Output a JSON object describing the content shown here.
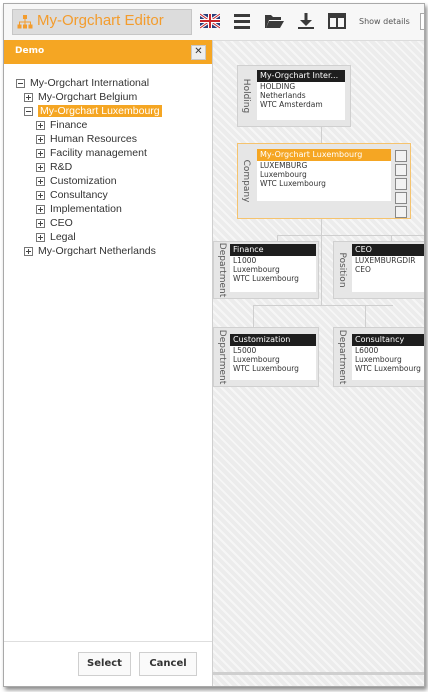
{
  "app": {
    "title": "My-Orgchart Editor"
  },
  "toolbar": {
    "show_details": "Show details"
  },
  "panel": {
    "title": "Demo",
    "close": "✕",
    "tree": [
      {
        "label": "My-Orgchart International",
        "level": 0,
        "expanded": true
      },
      {
        "label": "My-Orgchart Belgium",
        "level": 1,
        "expanded": false
      },
      {
        "label": "My-Orgchart Luxembourg",
        "level": 1,
        "expanded": true,
        "selected": true
      },
      {
        "label": "Finance",
        "level": 2,
        "expanded": false
      },
      {
        "label": "Human Resources",
        "level": 2,
        "expanded": false
      },
      {
        "label": "Facility management",
        "level": 2,
        "expanded": false
      },
      {
        "label": "R&D",
        "level": 2,
        "expanded": false
      },
      {
        "label": "Customization",
        "level": 2,
        "expanded": false
      },
      {
        "label": "Consultancy",
        "level": 2,
        "expanded": false
      },
      {
        "label": "Implementation",
        "level": 2,
        "expanded": false
      },
      {
        "label": "CEO",
        "level": 2,
        "expanded": false
      },
      {
        "label": "Legal",
        "level": 2,
        "expanded": false
      },
      {
        "label": "My-Orgchart Netherlands",
        "level": 1,
        "expanded": false
      }
    ],
    "select_label": "Select",
    "cancel_label": "Cancel"
  },
  "chart": {
    "nodes": [
      {
        "type": "Holding",
        "title": "My-Orgchart Inter...",
        "lines": [
          "HOLDING",
          "Netherlands",
          "WTC Amsterdam"
        ]
      },
      {
        "type": "Company",
        "title": "My-Orgchart Luxembourg",
        "lines": [
          "LUXEMBURG",
          "Luxembourg",
          "WTC Luxembourg"
        ]
      },
      {
        "type": "Department",
        "title": "Finance",
        "lines": [
          "L1000",
          "Luxembourg",
          "WTC Luxembourg"
        ]
      },
      {
        "type": "Position",
        "title": "CEO",
        "lines": [
          "LUXEMBURGDIR",
          "CEO"
        ]
      },
      {
        "type": "Department",
        "title": "Customization",
        "lines": [
          "L5000",
          "Luxembourg",
          "WTC Luxembourg"
        ]
      },
      {
        "type": "Department",
        "title": "Consultancy",
        "lines": [
          "L6000",
          "Luxembourg",
          "WTC Luxembourg"
        ]
      }
    ]
  },
  "colors": {
    "accent": "#f5a623",
    "card_header": "#1e1e1e"
  },
  "icons": [
    "orgchart-logo-icon",
    "uk-flag-icon",
    "menu-icon",
    "folder-open-icon",
    "download-icon",
    "layout-icon",
    "close-icon",
    "expand-icon",
    "collapse-icon"
  ]
}
